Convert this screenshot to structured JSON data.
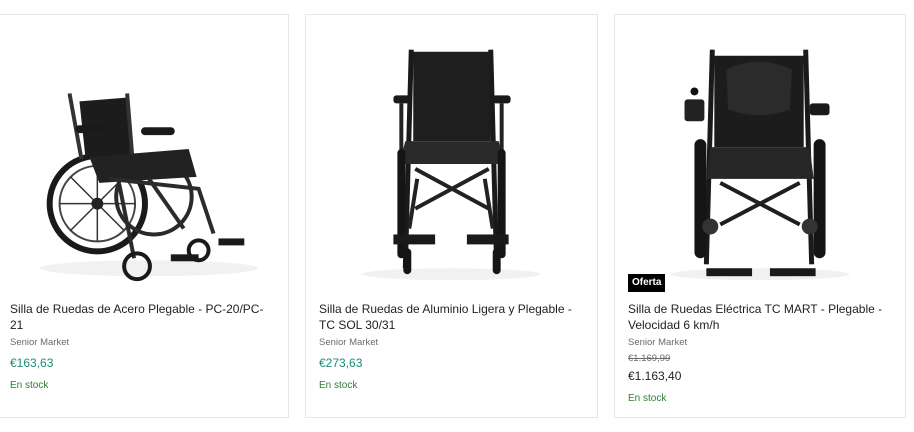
{
  "products": [
    {
      "title": "Silla de Ruedas de Acero Plegable - PC-20/PC-21",
      "brand": "Senior Market",
      "price": "€163,63",
      "stock": "En stock",
      "image_icon": "wheelchair-steel-image"
    },
    {
      "title": "Silla de Ruedas de Aluminio Ligera y Plegable - TC SOL 30/31",
      "brand": "Senior Market",
      "price": "€273,63",
      "stock": "En stock",
      "image_icon": "wheelchair-aluminium-image"
    },
    {
      "title": "Silla de Ruedas Eléctrica TC MART - Plegable - Velocidad 6 km/h",
      "brand": "Senior Market",
      "badge": "Oferta",
      "price_old": "€1.169,99",
      "price_new": "€1.163,40",
      "stock": "En stock",
      "image_icon": "wheelchair-electric-image"
    }
  ],
  "colors": {
    "price": "#1a8d74",
    "stock": "#2e7d32",
    "badge_bg": "#000000",
    "card_border": "#e6e6e6"
  }
}
